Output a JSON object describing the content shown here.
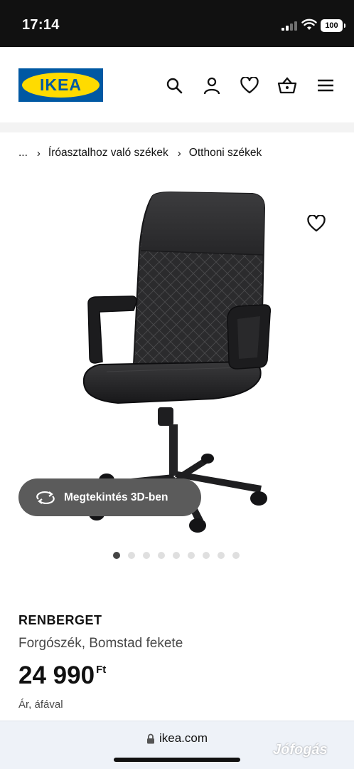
{
  "status_bar": {
    "time": "17:14",
    "battery": "100"
  },
  "header": {
    "logo_text": "IKEA",
    "icons": [
      "search-icon",
      "user-icon",
      "heart-icon",
      "shopping-bag-icon",
      "menu-icon"
    ]
  },
  "breadcrumb": {
    "items": [
      "...",
      "Íróasztalhoz való székek",
      "Otthoni székek"
    ]
  },
  "gallery": {
    "view_3d_label": "Megtekintés 3D-ben",
    "dot_count": 9,
    "active_dot": 0
  },
  "product": {
    "name": "RENBERGET",
    "description": "Forgószék, Bomstad fekete",
    "price": "24 990",
    "currency": "Ft",
    "vat_note": "Ár, áfával"
  },
  "browser": {
    "url": "ikea.com"
  },
  "watermark": "Jófogás",
  "colors": {
    "ikea_blue": "#0058a3",
    "ikea_yellow": "#ffdb00",
    "pill_bg": "#5b5b5b"
  }
}
